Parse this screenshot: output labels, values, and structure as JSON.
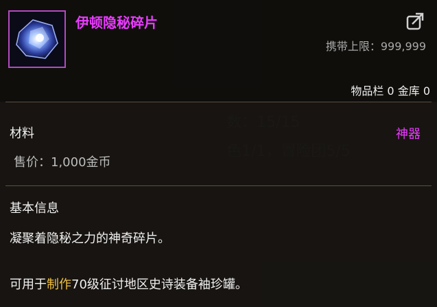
{
  "item": {
    "name": "伊顿隐秘碎片",
    "carry_limit_label": "携带上限：",
    "carry_limit_value": "999,999",
    "inventory_label": "物品栏",
    "inventory_count": "0",
    "storage_label": "金库",
    "storage_count": "0",
    "type": "材料",
    "rarity": "神器",
    "price_label": "售价：",
    "price_value": "1,000金币",
    "section_title": "基本信息",
    "description": "凝聚着隐秘之力的神奇碎片。",
    "usage_prefix": "可用于",
    "usage_highlight": "制作",
    "usage_suffix": "70级征讨地区史诗装备袖珍罐。"
  },
  "colors": {
    "title": "#ea3cff",
    "rarity": "#ea3cff",
    "highlight": "#f0c040",
    "frame": "#b44bc0"
  },
  "icons": {
    "item": "crystal-shard-icon",
    "export": "export-arrow-icon"
  }
}
